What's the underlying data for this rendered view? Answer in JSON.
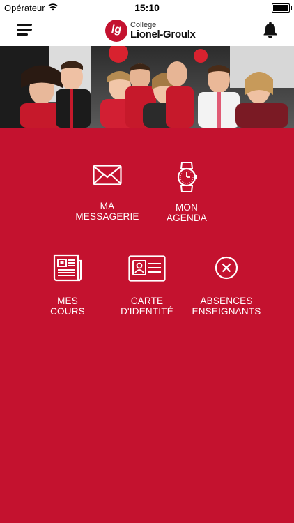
{
  "status_bar": {
    "carrier": "Opérateur",
    "time": "15:10"
  },
  "header": {
    "logo_line1": "Collège",
    "logo_line2": "Lionel-Groulx",
    "logo_mark": "lg"
  },
  "hero": {
    "description_icon": "group-photo"
  },
  "tiles": [
    {
      "line1": "MA",
      "line2": "MESSAGERIE",
      "icon": "envelope-icon"
    },
    {
      "line1": "MON",
      "line2": "AGENDA",
      "icon": "watch-icon"
    },
    {
      "line1": "MES",
      "line2": "COURS",
      "icon": "newspaper-icon"
    },
    {
      "line1": "CARTE",
      "line2": "D'IDENTITÉ",
      "icon": "id-card-icon"
    },
    {
      "line1": "ABSENCES",
      "line2": "ENSEIGNANTS",
      "icon": "x-circle-icon"
    }
  ],
  "colors": {
    "brand_red": "#c4122f",
    "white": "#ffffff"
  }
}
